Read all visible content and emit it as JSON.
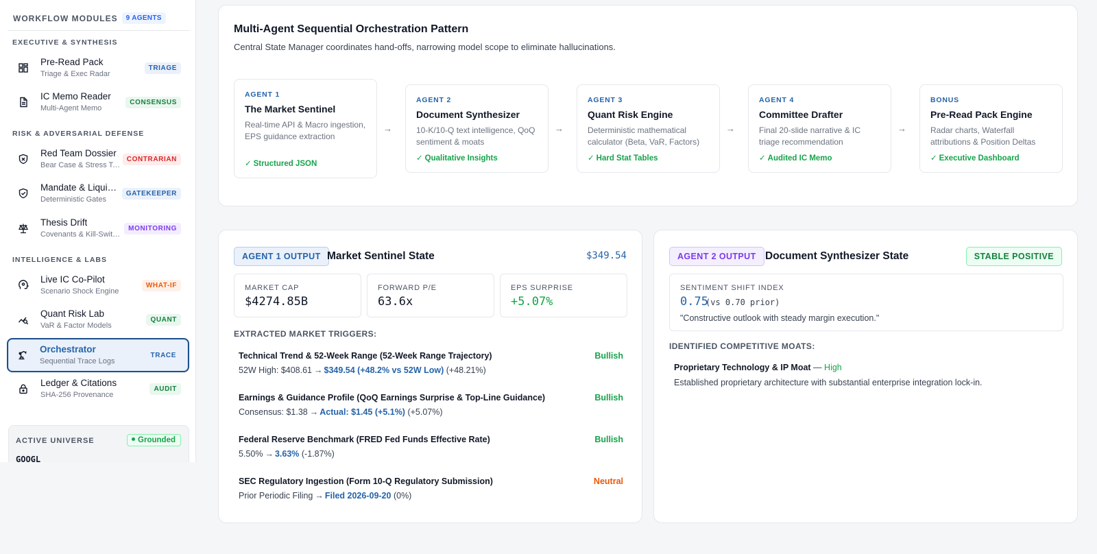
{
  "sidebar": {
    "header": {
      "title": "WORKFLOW MODULES",
      "badge": "9 AGENTS"
    },
    "sections": [
      "EXECUTIVE & SYNTHESIS",
      "RISK & ADVERSARIAL DEFENSE",
      "INTELLIGENCE & LABS"
    ],
    "items": [
      {
        "title": "Pre-Read Pack",
        "subtitle": "Triage & Exec Radar",
        "tag": "TRIAGE",
        "icon": "grid-icon"
      },
      {
        "title": "IC Memo Reader",
        "subtitle": "Multi-Agent Memo",
        "tag": "CONSENSUS",
        "icon": "document-icon"
      },
      {
        "title": "Red Team Dossier",
        "subtitle": "Bear Case & Stress Tests",
        "tag": "CONTRARIAN",
        "icon": "shield-x-icon"
      },
      {
        "title": "Mandate & Liquidity",
        "subtitle": "Deterministic Gates",
        "tag": "GATEKEEPER",
        "icon": "shield-check-icon"
      },
      {
        "title": "Thesis Drift",
        "subtitle": "Covenants & Kill-Switches",
        "tag": "MONITORING",
        "icon": "scale-icon"
      },
      {
        "title": "Live IC Co-Pilot",
        "subtitle": "Scenario Shock Engine",
        "tag": "WHAT-IF",
        "icon": "brain-icon"
      },
      {
        "title": "Quant Risk Lab",
        "subtitle": "VaR & Factor Models",
        "tag": "QUANT",
        "icon": "chart-search-icon"
      },
      {
        "title": "Orchestrator",
        "subtitle": "Sequential Trace Logs",
        "tag": "TRACE",
        "icon": "robot-arm-icon"
      },
      {
        "title": "Ledger & Citations",
        "subtitle": "SHA-256 Provenance",
        "tag": "AUDIT",
        "icon": "lock-icon"
      }
    ],
    "universe": {
      "label": "ACTIVE UNIVERSE",
      "badge": "Grounded",
      "ticker": "GOOGL"
    }
  },
  "orchestration": {
    "title": "Multi-Agent Sequential Orchestration Pattern",
    "subtitle": "Central State Manager coordinates hand-offs, narrowing model scope to eliminate hallucinations.",
    "agents": [
      {
        "kicker": "AGENT 1",
        "name": "The Market Sentinel",
        "desc": "Real-time API & Macro ingestion, EPS guidance extraction",
        "output": "Structured JSON"
      },
      {
        "kicker": "AGENT 2",
        "name": "Document Synthesizer",
        "desc": "10-K/10-Q text intelligence, QoQ sentiment & moats",
        "output": "Qualitative Insights"
      },
      {
        "kicker": "AGENT 3",
        "name": "Quant Risk Engine",
        "desc": "Deterministic mathematical calculator (Beta, VaR, Factors)",
        "output": "Hard Stat Tables"
      },
      {
        "kicker": "AGENT 4",
        "name": "Committee Drafter",
        "desc": "Final 20-slide narrative & IC triage recommendation",
        "output": "Audited IC Memo"
      },
      {
        "kicker": "BONUS",
        "name": "Pre-Read Pack Engine",
        "desc": "Radar charts, Waterfall attributions & Position Deltas",
        "output": "Executive Dashboard"
      }
    ],
    "arrow": "→"
  },
  "market_state": {
    "badge": "AGENT 1 OUTPUT",
    "title": "Market Sentinel State",
    "price": "$349.54",
    "metrics": [
      {
        "label": "MARKET CAP",
        "value": "$4274.85B"
      },
      {
        "label": "FORWARD P/E",
        "value": "63.6x"
      },
      {
        "label": "EPS SURPRISE",
        "value": "+5.07%"
      }
    ],
    "triggers_label": "EXTRACTED MARKET TRIGGERS:",
    "triggers": [
      {
        "title": "Technical Trend & 52-Week Range (52-Week Range Trajectory)",
        "signal": "Bullish",
        "from": "52W High: $408.61",
        "to": "$349.54 (+48.2% vs 52W Low)",
        "delta": "(+48.21%)"
      },
      {
        "title": "Earnings & Guidance Profile (QoQ Earnings Surprise & Top-Line Guidance)",
        "signal": "Bullish",
        "from": "Consensus: $1.38",
        "to": "Actual: $1.45 (+5.1%)",
        "delta": "(+5.07%)"
      },
      {
        "title": "Federal Reserve Benchmark (FRED Fed Funds Effective Rate)",
        "signal": "Bullish",
        "from": "5.50%",
        "to": "3.63%",
        "delta": "(-1.87%)"
      },
      {
        "title": "SEC Regulatory Ingestion (Form 10-Q Regulatory Submission)",
        "signal": "Neutral",
        "from": "Prior Periodic Filing",
        "to": "Filed 2026-09-20",
        "delta": "(0%)"
      }
    ]
  },
  "doc_state": {
    "badge": "AGENT 2 OUTPUT",
    "title": "Document Synthesizer State",
    "status": "STABLE POSITIVE",
    "ssi": {
      "label": "SENTIMENT SHIFT INDEX",
      "value": "0.75",
      "prior": "(vs 0.70 prior)",
      "quote": "\"Constructive outlook with steady margin execution.\""
    },
    "moats_label": "IDENTIFIED COMPETITIVE MOATS:",
    "moats": [
      {
        "title": "Proprietary Technology & IP Moat",
        "separator": "—",
        "level": "High",
        "desc": "Established proprietary architecture with substantial enterprise integration lock-in."
      }
    ]
  },
  "colors": {
    "accent": "#2563a8",
    "bullish": "#16a34a",
    "neutral": "#ea580c",
    "active_border": "#1e4f8c"
  }
}
